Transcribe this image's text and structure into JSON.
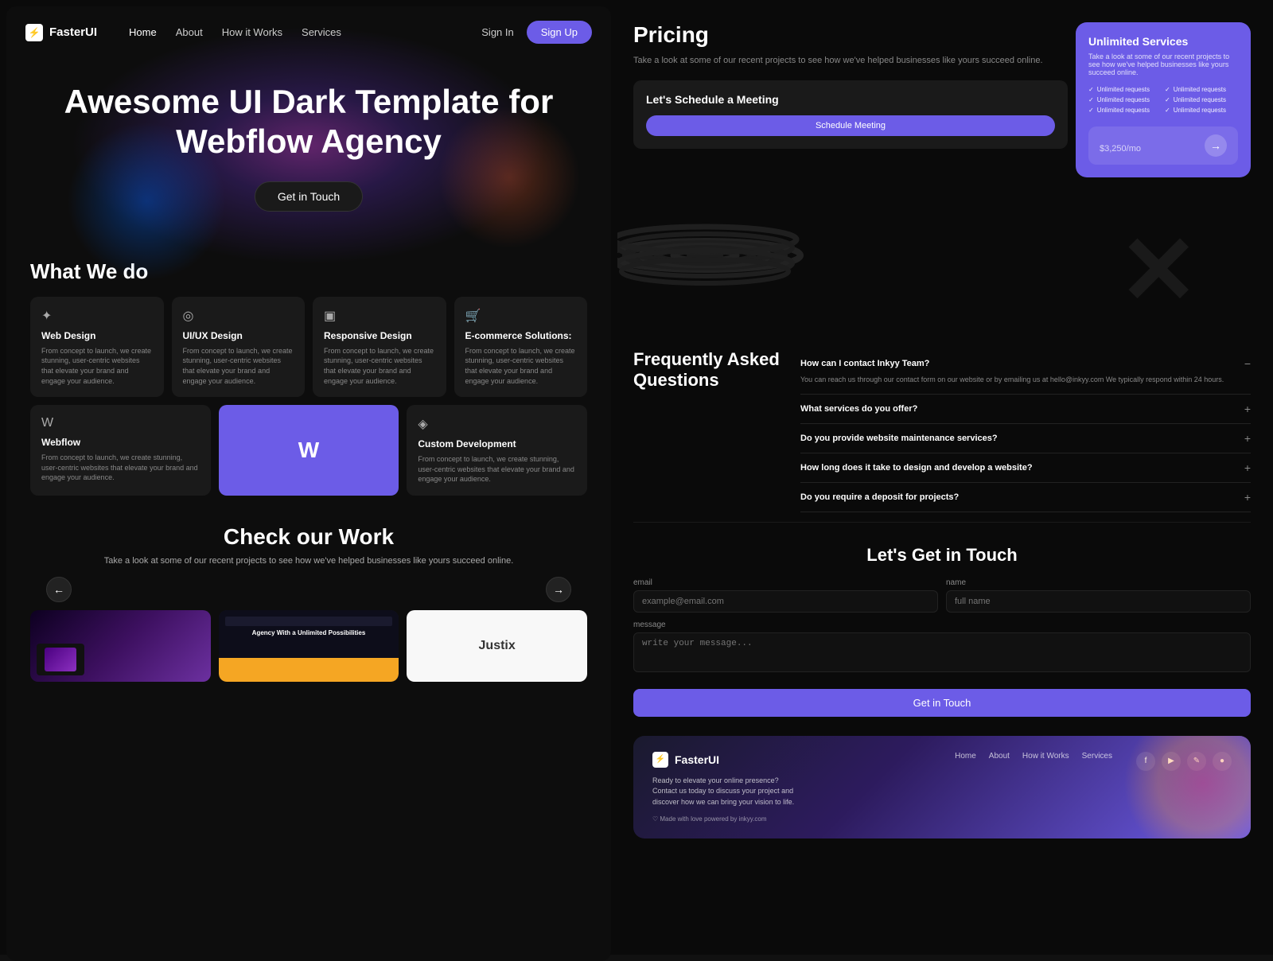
{
  "app": {
    "title": "FasterUI",
    "logo_icon": "⚡"
  },
  "nav": {
    "links": [
      {
        "label": "Home",
        "active": true
      },
      {
        "label": "About",
        "active": false
      },
      {
        "label": "How it Works",
        "active": false
      },
      {
        "label": "Services",
        "active": false
      }
    ],
    "signin": "Sign In",
    "signup": "Sign Up"
  },
  "hero": {
    "heading": "Awesome UI Dark Template for Webflow Agency",
    "cta": "Get in Touch"
  },
  "what_we_do": {
    "heading": "What We do",
    "services": [
      {
        "icon": "✦",
        "title": "Web Design",
        "description": "From concept to launch, we create stunning, user-centric websites that elevate your brand and engage your audience."
      },
      {
        "icon": "◎",
        "title": "UI/UX Design",
        "description": "From concept to launch, we create stunning, user-centric websites that elevate your brand and engage your audience."
      },
      {
        "icon": "▣",
        "title": "Responsive Design",
        "description": "From concept to launch, we create stunning, user-centric websites that elevate your brand and engage your audience."
      },
      {
        "icon": "🛒",
        "title": "E-commerce Solutions:",
        "description": "From concept to launch, we create stunning, user-centric websites that elevate your brand and engage your audience."
      },
      {
        "icon": "W",
        "title": "Webflow",
        "description": "From concept to launch, we create stunning, user-centric websites that elevate your brand and engage your audience.",
        "is_webflow": true
      },
      {
        "icon": "◈",
        "title": "Custom Development",
        "description": "From concept to launch, we create stunning, user-centric websites that elevate your brand and engage your audience."
      }
    ]
  },
  "check_work": {
    "heading": "Check our Work",
    "description": "Take a look at some of our recent projects to see how we've helped businesses like yours succeed online.",
    "prev_icon": "←",
    "next_icon": "→",
    "thumbnails": [
      {
        "alt": "Dark project thumbnail"
      },
      {
        "alt": "Agency With a Unlimited Possibilities",
        "text": "Agency With a Unlimited Possibilities"
      },
      {
        "alt": "Justix project thumbnail",
        "text": "Justix"
      }
    ]
  },
  "pricing": {
    "heading": "Pricing",
    "description": "Take a look at some of our recent projects to see how we've helped businesses like yours succeed online.",
    "schedule": {
      "heading": "Let's Schedule a Meeting",
      "button": "Schedule Meeting"
    },
    "plan": {
      "name": "Unlimited Services",
      "subtitle": "Take a look at some of our recent projects to see how we've helped businesses like yours succeed online.",
      "features": [
        "Unlimited requests",
        "Unlimited requests",
        "Unlimited requests",
        "Unlimited requests",
        "Unlimited requests",
        "Unlimited requests"
      ],
      "price": "$3,250",
      "period": "/mo",
      "arrow": "→"
    }
  },
  "faq": {
    "heading": "Frequently Asked Questions",
    "items": [
      {
        "question": "How can I contact Inkyy Team?",
        "answer": "You can reach us through our contact form on our website or by emailing us at hello@inkyy.com We typically respond within 24 hours.",
        "open": true
      },
      {
        "question": "What services do you offer?",
        "answer": "",
        "open": false
      },
      {
        "question": "Do you provide website maintenance services?",
        "answer": "",
        "open": false
      },
      {
        "question": "How long does it take to design and develop a website?",
        "answer": "",
        "open": false
      },
      {
        "question": "Do you require a deposit for projects?",
        "answer": "",
        "open": false
      }
    ]
  },
  "contact": {
    "heading": "Let's Get in Touch",
    "fields": {
      "email_label": "email",
      "email_placeholder": "example@email.com",
      "name_label": "name",
      "name_placeholder": "full name",
      "message_label": "message",
      "message_placeholder": "write your message..."
    },
    "submit": "Get in Touch"
  },
  "footer": {
    "logo": "FasterUI",
    "logo_icon": "⚡",
    "description": "Ready to elevate your online presence? Contact us today to discuss your project and discover how we can bring your vision to life.",
    "love": "♡ Made with love powered by inkyy.com",
    "nav_links": [
      "Home",
      "About",
      "How it Works",
      "Services"
    ],
    "social": [
      "f",
      "▶",
      "✎",
      "●"
    ]
  }
}
